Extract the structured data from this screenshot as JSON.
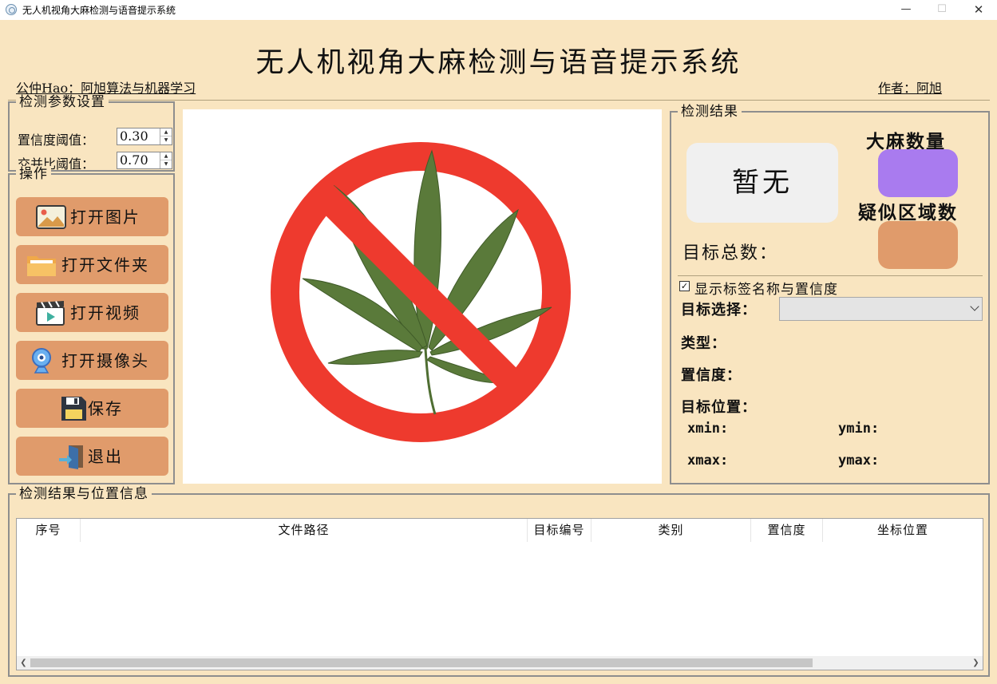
{
  "window": {
    "title": "无人机视角大麻检测与语音提示系统",
    "min_glyph": "—",
    "max_glyph": "☐",
    "close_glyph": "✕"
  },
  "header": {
    "title": "无人机视角大麻检测与语音提示系统",
    "left_link": "公仲Hao：阿旭算法与机器学习",
    "right_link": "作者：阿旭"
  },
  "params": {
    "group_title": "检测参数设置",
    "confidence_label": "置信度阈值：",
    "confidence_value": "0.30",
    "iou_label": "交并比阈值：",
    "iou_value": "0.70"
  },
  "operations": {
    "group_title": "操作",
    "open_image": "打开图片",
    "open_folder": "打开文件夹",
    "open_video": "打开视频",
    "open_camera": "打开摄像头",
    "save": "保存",
    "exit": "退出"
  },
  "result": {
    "group_title": "检测结果",
    "no_result": "暂无",
    "cannabis_count_label": "大麻数量",
    "suspicious_area_label": "疑似区域数",
    "total_label": "目标总数：",
    "show_label_checkbox": "显示标签名称与置信度",
    "target_select_label": "目标选择：",
    "type_label": "类型：",
    "confidence_label": "置信度：",
    "position_label": "目标位置：",
    "xmin": "xmin:",
    "ymin": "ymin:",
    "xmax": "xmax:",
    "ymax": "ymax:"
  },
  "table": {
    "group_title": "检测结果与位置信息",
    "columns": [
      "序号",
      "文件路径",
      "目标编号",
      "类别",
      "置信度",
      "坐标位置"
    ]
  },
  "colors": {
    "background": "#f9e5c0",
    "button": "#e09b6b",
    "cannabis_badge": "#a97bef",
    "area_badge": "#e09b6b",
    "prohibition_red": "#ee3a2e",
    "leaf_green": "#5a7a3a"
  }
}
